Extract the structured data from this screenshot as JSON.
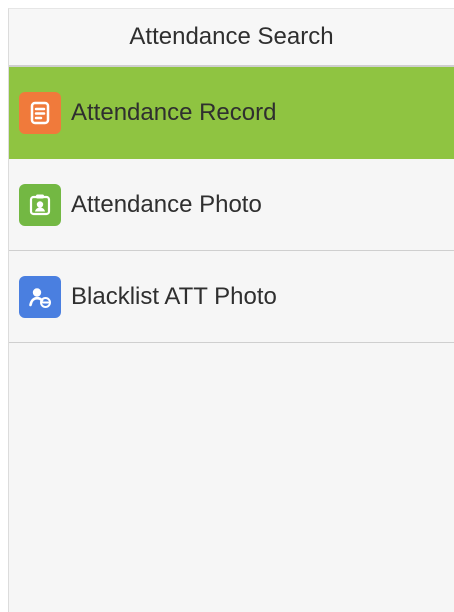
{
  "header": {
    "title": "Attendance Search"
  },
  "menu": {
    "items": [
      {
        "label": "Attendance Record",
        "icon": "document-icon",
        "icon_color": "#f07a3b",
        "selected": true
      },
      {
        "label": "Attendance Photo",
        "icon": "photo-id-icon",
        "icon_color": "#73b843",
        "selected": false
      },
      {
        "label": "Blacklist ATT Photo",
        "icon": "blocked-user-icon",
        "icon_color": "#4a7fe0",
        "selected": false
      }
    ]
  },
  "colors": {
    "selected_row": "#8fc441",
    "background": "#f6f6f6",
    "divider": "#cfcfcf",
    "text": "#2f2f2f"
  }
}
